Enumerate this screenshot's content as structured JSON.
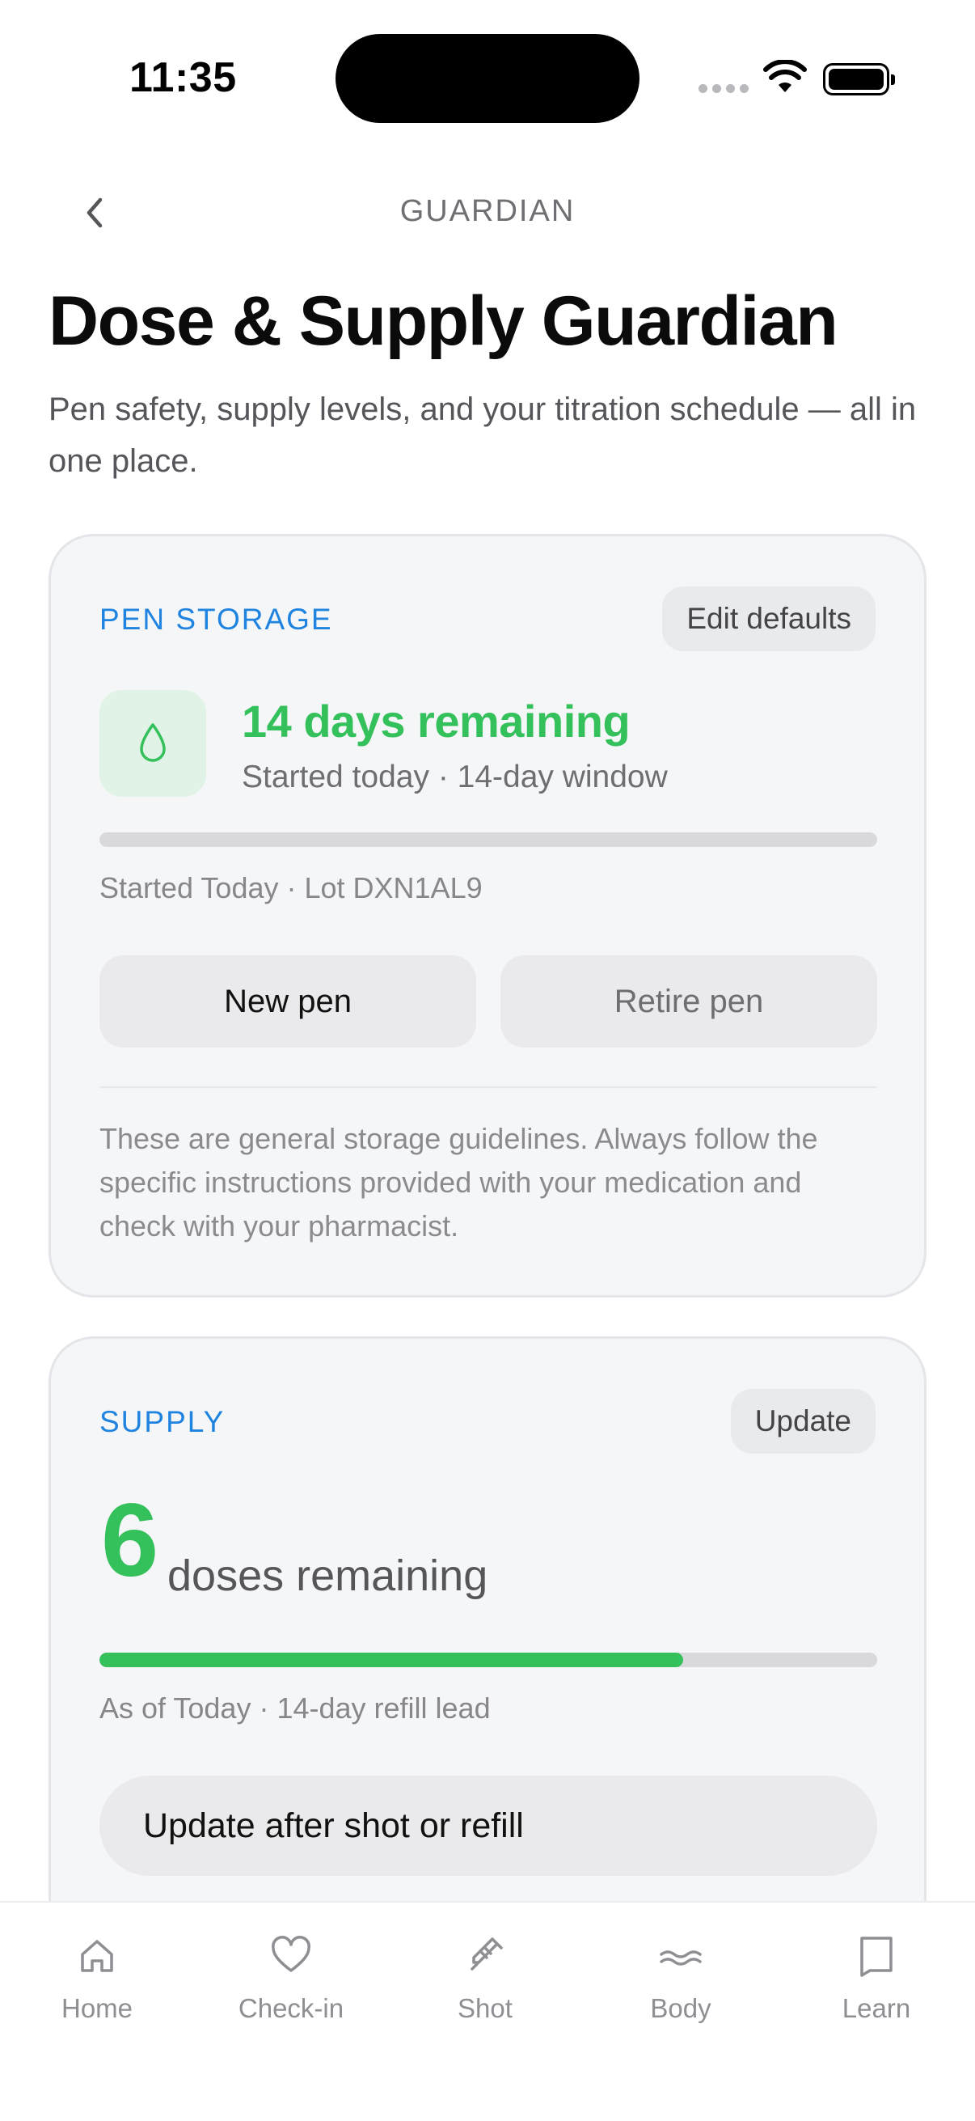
{
  "status_bar": {
    "time": "11:35",
    "icons": [
      "signal-icon",
      "wifi-icon",
      "battery-icon"
    ]
  },
  "nav": {
    "back_icon": "chevron-left-icon",
    "title": "GUARDIAN"
  },
  "header": {
    "title": "Dose & Supply Guardian",
    "subtitle": "Pen safety, supply levels, and your titration schedule — all in one place."
  },
  "pen_storage": {
    "label": "PEN STORAGE",
    "edit_label": "Edit defaults",
    "icon": "drop-icon",
    "days_title": "14 days remaining",
    "days_sub": "Started today · 14-day window",
    "progress_fraction": 0,
    "meta": "Started Today · Lot DXN1AL9",
    "new_pen_label": "New pen",
    "retire_pen_label": "Retire pen",
    "disclaimer": "These are general storage guidelines. Always follow the specific instructions provided with your medication and check with your pharmacist."
  },
  "supply": {
    "label": "SUPPLY",
    "update_label": "Update",
    "doses_count": "6",
    "doses_label": "doses remaining",
    "progress_fraction": 0.75,
    "meta": "As of Today · 14-day refill lead",
    "update_button_label": "Update after shot or refill"
  },
  "tab_bar": {
    "tabs": [
      {
        "label": "Home",
        "icon": "home-icon"
      },
      {
        "label": "Check-in",
        "icon": "heart-icon"
      },
      {
        "label": "Shot",
        "icon": "syringe-icon"
      },
      {
        "label": "Body",
        "icon": "waves-icon"
      },
      {
        "label": "Learn",
        "icon": "book-icon"
      }
    ]
  },
  "colors": {
    "accent_blue": "#1f83e0",
    "accent_green": "#34c05a",
    "card_bg": "#f5f6f8"
  }
}
